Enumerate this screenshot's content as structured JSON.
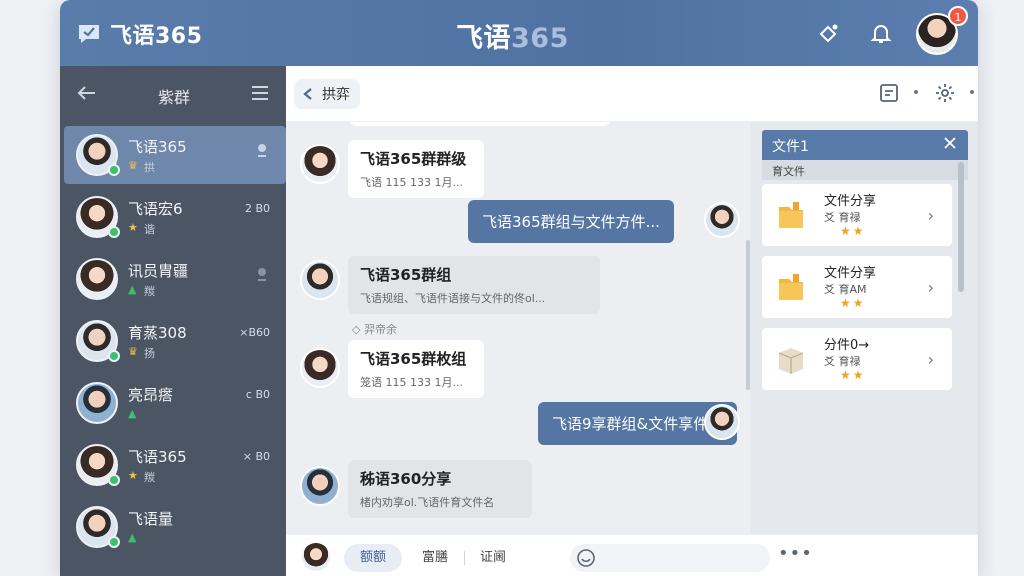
{
  "titlebar": {
    "brand_name": "飞语365",
    "center_title_main": "飞语",
    "center_title_dim": "365",
    "notif_badge": "1"
  },
  "sidebar": {
    "title": "紫群",
    "contacts": [
      {
        "name": "飞语365",
        "sub": "拱",
        "meta": "",
        "active": true
      },
      {
        "name": "飞语宏6",
        "sub": "谐",
        "meta": "2 B0"
      },
      {
        "name": "讯员胄疆",
        "sub": "羰",
        "meta": ""
      },
      {
        "name": "育蒸308",
        "sub": "扬",
        "meta": "×B60"
      },
      {
        "name": "亮昂瘩",
        "sub": "",
        "meta": "c B0"
      },
      {
        "name": "飞语365",
        "sub": "羰",
        "meta": "× B0"
      },
      {
        "name": "飞语量",
        "sub": "",
        "meta": ""
      }
    ]
  },
  "chat_header": {
    "crumb": "拱弈"
  },
  "messages": [
    {
      "side": "left",
      "title": "飞语365群群级",
      "sub": "飞语 115 133 1月..."
    },
    {
      "side": "right",
      "text": "飞语365群组与文件方件..."
    },
    {
      "side": "left",
      "title": "飞语365群组",
      "sub": "飞语规组、飞语件语接与文件的佟ol..."
    },
    {
      "side": "note",
      "text": "羿帝余"
    },
    {
      "side": "left",
      "title": "飞语365群枚组",
      "sub": "笼语 115 133 1月..."
    },
    {
      "side": "right",
      "text": "飞语9享群组&文件享件..."
    },
    {
      "side": "left",
      "title": "秭语360分享",
      "sub": "楮内劝享ol.飞语件育文件名"
    }
  ],
  "file_panel": {
    "title": "文件1",
    "subtitle": "育文件",
    "files": [
      {
        "name": "文件分享",
        "sub": "爻 育禄",
        "stars": "★★"
      },
      {
        "name": "文件分享",
        "sub": "爻 育AM",
        "stars": "★★"
      },
      {
        "name": "分件0→",
        "sub": "爻 育禄",
        "stars": "★★"
      }
    ]
  },
  "input_bar": {
    "tabs": [
      "额额",
      "富膳",
      "证阃"
    ]
  },
  "colors": {
    "brand_blue": "#5576a3",
    "sidebar_bg": "#4b5563",
    "online_dot": "#3cc06b",
    "badge_red": "#f05a45",
    "star_gold": "#f0a422"
  }
}
